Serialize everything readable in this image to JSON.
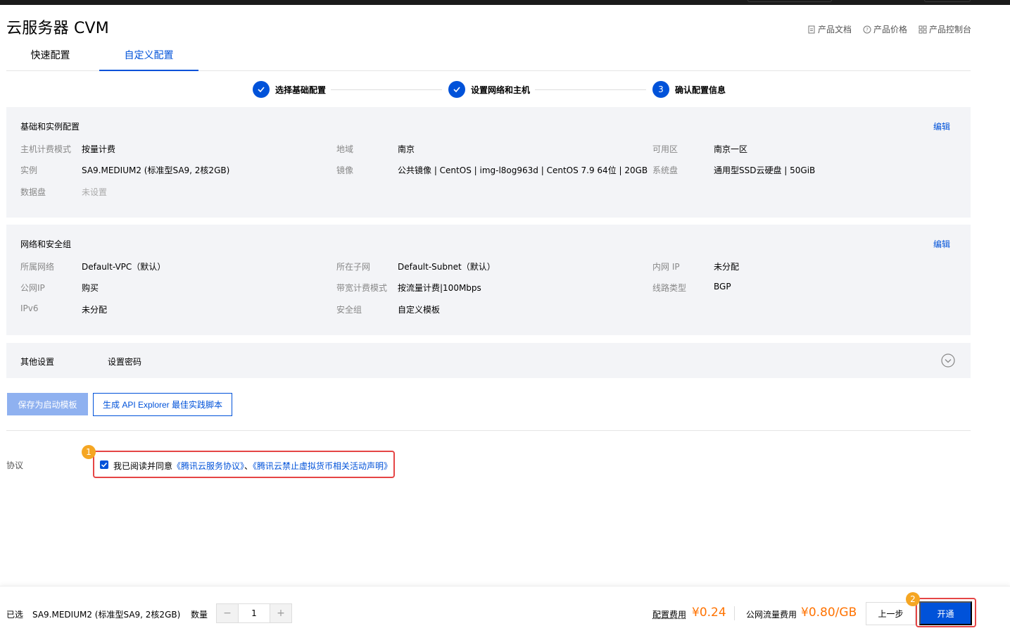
{
  "header": {
    "title": "云服务器 CVM",
    "links": [
      "产品文档",
      "产品价格",
      "产品控制台"
    ]
  },
  "tabs": [
    "快速配置",
    "自定义配置"
  ],
  "steps": [
    {
      "label": "选择基础配置",
      "mark": "check-icon"
    },
    {
      "label": "设置网络和主机",
      "mark": "check-icon"
    },
    {
      "label": "确认配置信息",
      "num": "3"
    }
  ],
  "basic": {
    "title": "基础和实例配置",
    "edit": "编辑",
    "fields": [
      {
        "label": "主机计费模式",
        "value": "按量计费"
      },
      {
        "label": "地域",
        "value": "南京"
      },
      {
        "label": "可用区",
        "value": "南京一区"
      },
      {
        "label": "实例",
        "value": "SA9.MEDIUM2 (标准型SA9, 2核2GB)"
      },
      {
        "label": "镜像",
        "value": "公共镜像 | CentOS | img-l8og963d | CentOS 7.9 64位 | 20GB"
      },
      {
        "label": "系统盘",
        "value": "通用型SSD云硬盘 | 50GiB"
      },
      {
        "label": "数据盘",
        "value": "未设置"
      }
    ]
  },
  "network": {
    "title": "网络和安全组",
    "edit": "编辑",
    "fields": [
      {
        "label": "所属网络",
        "value": "Default-VPC（默认）"
      },
      {
        "label": "所在子网",
        "value": "Default-Subnet（默认）"
      },
      {
        "label": "内网 IP",
        "value": "未分配"
      },
      {
        "label": "公网IP",
        "value": "购买"
      },
      {
        "label": "带宽计费模式",
        "value": "按流量计费|100Mbps"
      },
      {
        "label": "线路类型",
        "value": "BGP"
      },
      {
        "label": "IPv6",
        "value": "未分配"
      },
      {
        "label": "安全组",
        "value": "自定义模板"
      }
    ]
  },
  "other": {
    "title": "其他设置",
    "value": "设置密码"
  },
  "actions": {
    "save_template": "保存为启动模板",
    "api_explorer": "生成 API Explorer 最佳实践脚本"
  },
  "agreement": {
    "label": "协议",
    "prefix": "我已阅读并同意",
    "link1": "《腾讯云服务协议》",
    "sep": "、",
    "link2": "《腾讯云禁止虚拟货币相关活动声明》",
    "checked": true
  },
  "badges": [
    "1",
    "2"
  ],
  "footer": {
    "selected_label": "已选",
    "selected_value": "SA9.MEDIUM2 (标准型SA9, 2核2GB)",
    "qty_label": "数量",
    "qty_minus": "−",
    "qty_value": "1",
    "qty_plus": "+",
    "config_fee_label": "配置费用",
    "config_fee_value": "¥0.24",
    "traffic_fee_label": "公网流量费用",
    "traffic_fee_value": "¥0.80/GB",
    "prev": "上一步",
    "open": "开通"
  },
  "colors": {
    "primary": "#0052d9",
    "price": "#ff7200",
    "highlight": "#e54545",
    "badge": "#f5a623"
  }
}
